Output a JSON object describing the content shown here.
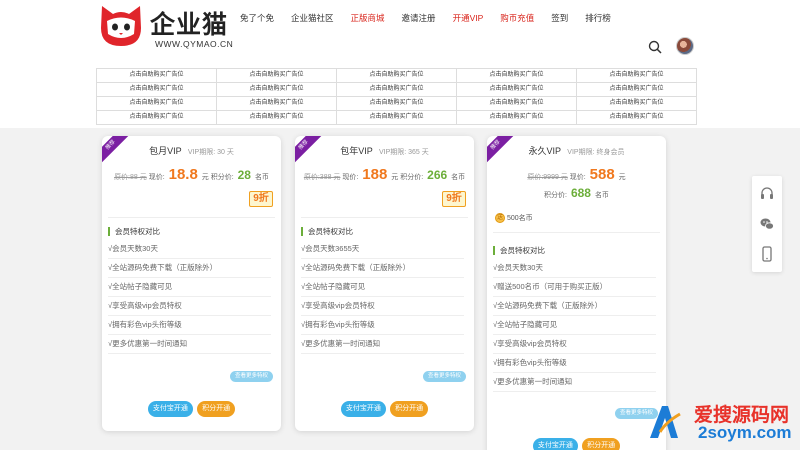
{
  "logo": {
    "text": "企业猫",
    "url": "WWW.QYMAO.CN"
  },
  "nav": {
    "items": [
      {
        "label": "免了个免",
        "highlight": false
      },
      {
        "label": "企业猫社区",
        "highlight": false
      },
      {
        "label": "正版商城",
        "highlight": true
      },
      {
        "label": "邀请注册",
        "highlight": false
      },
      {
        "label": "开通VIP",
        "highlight": true
      },
      {
        "label": "购币充值",
        "highlight": true
      },
      {
        "label": "签到",
        "highlight": false
      },
      {
        "label": "排行榜",
        "highlight": false
      }
    ]
  },
  "ads": {
    "cell_label": "点击自助购买广告位",
    "rows": 4,
    "cols": 5
  },
  "cards": [
    {
      "ribbon": "推荐",
      "name": "包月VIP",
      "period": "VIP期限: 30 天",
      "orig_label": "原价:88 元",
      "now_label": "现价:",
      "price": "18.8",
      "unit": "元",
      "points_label": "积分价:",
      "points": "28",
      "points_unit": "名币",
      "discount": "9折",
      "section": "会员特权对比",
      "features": [
        "√会员天数30天",
        "√全站源码免费下载（正版除外）",
        "√全站帖子隐藏可见",
        "√享受高级vip会员特权",
        "√拥有彩色vip头衔等级",
        "√更多优惠第一时间通知"
      ],
      "more": "查看更多特权",
      "btn_alipay": "支付宝开通",
      "btn_points": "积分开通"
    },
    {
      "ribbon": "推荐",
      "name": "包年VIP",
      "period": "VIP期限: 365 天",
      "orig_label": "原价:388 元",
      "now_label": "现价:",
      "price": "188",
      "unit": "元",
      "points_label": "积分价:",
      "points": "266",
      "points_unit": "名币",
      "discount": "9折",
      "section": "会员特权对比",
      "features": [
        "√会员天数3655天",
        "√全站源码免费下载（正版除外）",
        "√全站帖子隐藏可见",
        "√享受高级vip会员特权",
        "√拥有彩色vip头衔等级",
        "√更多优惠第一时间通知"
      ],
      "more": "查看更多特权",
      "btn_alipay": "支付宝开通",
      "btn_points": "积分开通"
    },
    {
      "ribbon": "推荐",
      "name": "永久VIP",
      "period": "VIP期限: 终身会员",
      "orig_label": "原价:9999 元",
      "now_label": "现价:",
      "price": "588",
      "unit": "元",
      "points_label": "积分价:",
      "points": "688",
      "points_unit": "名币",
      "coin_icon": "送",
      "coins": "500名币",
      "section": "会员特权对比",
      "features": [
        "√会员天数30天",
        "√赠送500名币（可用于购买正版）",
        "√全站源码免费下载（正版除外）",
        "√全站帖子隐藏可见",
        "√享受高级vip会员特权",
        "√拥有彩色vip头衔等级",
        "√更多优惠第一时间通知"
      ],
      "more": "查看更多特权",
      "btn_alipay": "支付宝开通",
      "btn_points": "积分开通"
    }
  ],
  "side_tools": [
    "headset-icon",
    "wechat-icon",
    "phone-icon"
  ],
  "watermark": {
    "line1": "爱搜源码网",
    "line2": "2soym.com"
  },
  "colors": {
    "accent_red": "#d9251c",
    "price_orange": "#f0781e",
    "points_green": "#6cae3a",
    "ribbon_purple": "#7b1fa2",
    "alipay_blue": "#3ab0e8",
    "points_orange": "#f0a020"
  }
}
